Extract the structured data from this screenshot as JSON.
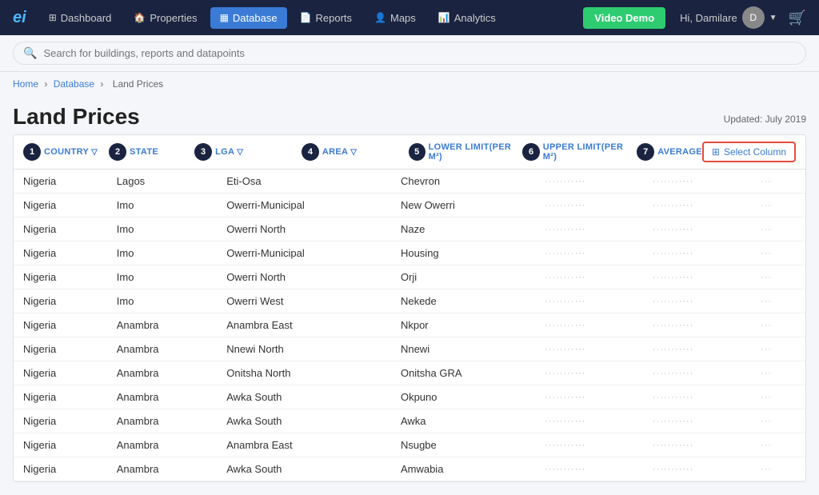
{
  "logo": "ei",
  "nav": {
    "items": [
      {
        "label": "Dashboard",
        "icon": "⊞",
        "active": false,
        "name": "dashboard"
      },
      {
        "label": "Properties",
        "icon": "🏠",
        "active": false,
        "name": "properties"
      },
      {
        "label": "Database",
        "icon": "🗄",
        "active": true,
        "name": "database"
      },
      {
        "label": "Reports",
        "icon": "📄",
        "active": false,
        "name": "reports"
      },
      {
        "label": "Maps",
        "icon": "👤",
        "active": false,
        "name": "maps"
      },
      {
        "label": "Analytics",
        "icon": "📊",
        "active": false,
        "name": "analytics"
      }
    ],
    "video_demo": "Video Demo",
    "user_greeting": "Hi, Damilare",
    "user_initial": "D"
  },
  "search": {
    "placeholder": "Search for buildings, reports and datapoints"
  },
  "breadcrumb": {
    "items": [
      "Home",
      "Database",
      "Land Prices"
    ]
  },
  "page": {
    "title": "Land Prices",
    "updated": "Updated: July 2019"
  },
  "columns": [
    {
      "num": "1",
      "label": "COUNTRY",
      "filter": true
    },
    {
      "num": "2",
      "label": "STATE",
      "filter": false
    },
    {
      "num": "3",
      "label": "LGA",
      "filter": true
    },
    {
      "num": "4",
      "label": "AREA",
      "filter": true
    },
    {
      "num": "5",
      "label": "LOWER LIMIT(PER M²)",
      "filter": false
    },
    {
      "num": "6",
      "label": "UPPER LIMIT(PER M²)",
      "filter": false
    },
    {
      "num": "7",
      "label": "AVERAGE",
      "filter": false
    }
  ],
  "select_column_btn": "Select Column",
  "rows": [
    {
      "country": "Nigeria",
      "state": "Lagos",
      "lga": "Eti-Osa",
      "area": "Chevron",
      "lower": "···········",
      "upper": "···········",
      "avg": "···"
    },
    {
      "country": "Nigeria",
      "state": "Imo",
      "lga": "Owerri-Municipal",
      "area": "New Owerri",
      "lower": "···········",
      "upper": "···········",
      "avg": "···"
    },
    {
      "country": "Nigeria",
      "state": "Imo",
      "lga": "Owerri North",
      "area": "Naze",
      "lower": "···········",
      "upper": "···········",
      "avg": "···"
    },
    {
      "country": "Nigeria",
      "state": "Imo",
      "lga": "Owerri-Municipal",
      "area": "Housing",
      "lower": "···········",
      "upper": "···········",
      "avg": "···"
    },
    {
      "country": "Nigeria",
      "state": "Imo",
      "lga": "Owerri North",
      "area": "Orji",
      "lower": "···········",
      "upper": "···········",
      "avg": "···"
    },
    {
      "country": "Nigeria",
      "state": "Imo",
      "lga": "Owerri West",
      "area": "Nekede",
      "lower": "···········",
      "upper": "···········",
      "avg": "···"
    },
    {
      "country": "Nigeria",
      "state": "Anambra",
      "lga": "Anambra East",
      "area": "Nkpor",
      "lower": "···········",
      "upper": "···········",
      "avg": "···"
    },
    {
      "country": "Nigeria",
      "state": "Anambra",
      "lga": "Nnewi North",
      "area": "Nnewi",
      "lower": "···········",
      "upper": "···········",
      "avg": "···"
    },
    {
      "country": "Nigeria",
      "state": "Anambra",
      "lga": "Onitsha North",
      "area": "Onitsha GRA",
      "lower": "···········",
      "upper": "···········",
      "avg": "···"
    },
    {
      "country": "Nigeria",
      "state": "Anambra",
      "lga": "Awka South",
      "area": "Okpuno",
      "lower": "···········",
      "upper": "···········",
      "avg": "···"
    },
    {
      "country": "Nigeria",
      "state": "Anambra",
      "lga": "Awka South",
      "area": "Awka",
      "lower": "···········",
      "upper": "···········",
      "avg": "···"
    },
    {
      "country": "Nigeria",
      "state": "Anambra",
      "lga": "Anambra East",
      "area": "Nsugbe",
      "lower": "···········",
      "upper": "···········",
      "avg": "···"
    },
    {
      "country": "Nigeria",
      "state": "Anambra",
      "lga": "Awka South",
      "area": "Amwabia",
      "lower": "···········",
      "upper": "···········",
      "avg": "···"
    }
  ]
}
